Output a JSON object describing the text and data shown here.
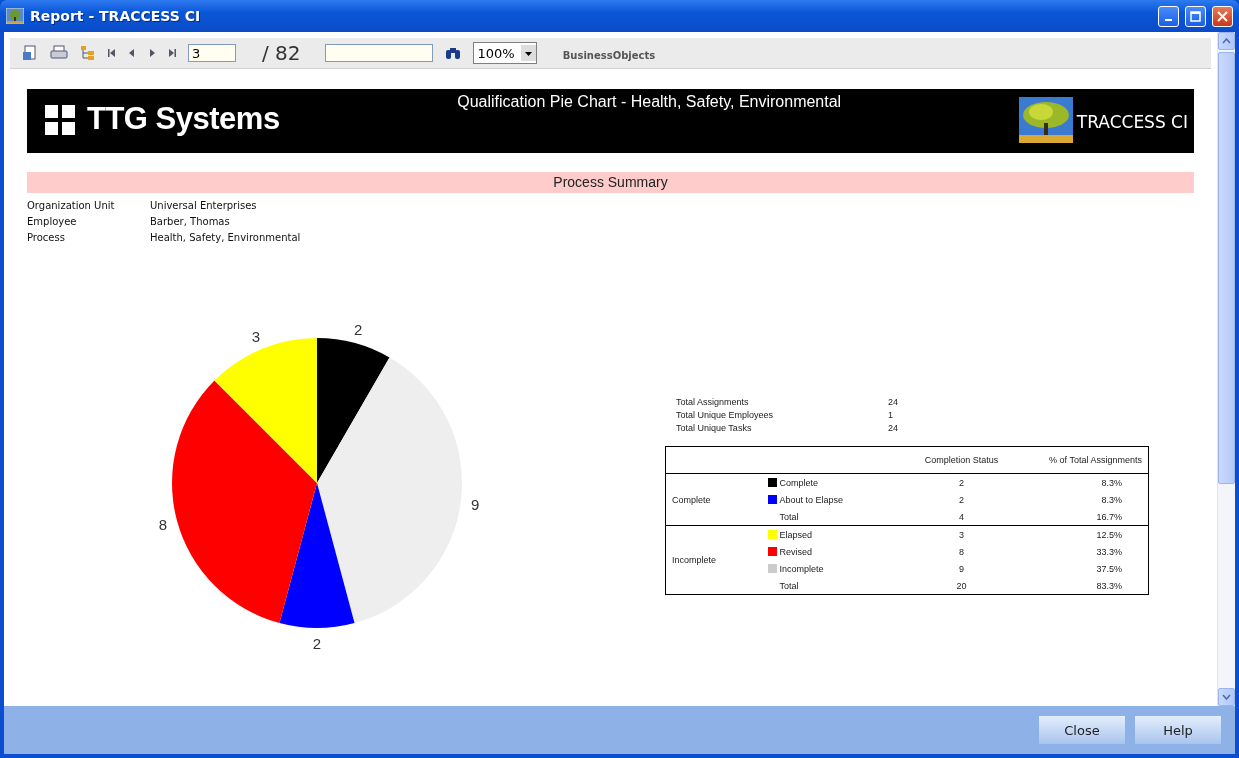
{
  "window": {
    "title": "Report - TRACCESS CI"
  },
  "toolbar": {
    "page": "3",
    "page_count": "/ 82",
    "zoom": "100%",
    "brand": "BusinessObjects"
  },
  "report": {
    "company": "TTG Systems",
    "title": "Qualification Pie Chart - Health, Safety, Environmental",
    "product": "TRACCESS CI",
    "section": "Process Summary",
    "fields": [
      {
        "label": "Organization Unit",
        "value": "Universal Enterprises"
      },
      {
        "label": "Employee",
        "value": "Barber, Thomas"
      },
      {
        "label": "Process",
        "value": "Health, Safety, Environmental"
      }
    ],
    "chart_data": {
      "type": "pie",
      "values": [
        2,
        9,
        2,
        8,
        3
      ],
      "colors": [
        "#000000",
        "#eeeeee",
        "#0000ff",
        "#ff0000",
        "#ffff00"
      ],
      "data_labels": true
    },
    "totals": [
      {
        "label": "Total Assignments",
        "value": "24"
      },
      {
        "label": "Total Unique Employees",
        "value": "1"
      },
      {
        "label": "Total Unique Tasks",
        "value": "24"
      }
    ],
    "table": {
      "columns": [
        "Completion Status",
        "% of Total Assignments"
      ],
      "groups": [
        {
          "name": "Complete",
          "rows": [
            {
              "kind": "item",
              "label": "Complete",
              "color": "#000000",
              "count": "2",
              "percent": "8.3%"
            },
            {
              "kind": "item",
              "label": "About to Elapse",
              "color": "#0000ff",
              "count": "2",
              "percent": "8.3%"
            },
            {
              "kind": "total",
              "label": "Total",
              "count": "4",
              "percent": "16.7%"
            }
          ]
        },
        {
          "name": "Incomplete",
          "rows": [
            {
              "kind": "item",
              "label": "Elapsed",
              "color": "#ffff00",
              "count": "3",
              "percent": "12.5%"
            },
            {
              "kind": "item",
              "label": "Revised",
              "color": "#ff0000",
              "count": "8",
              "percent": "33.3%"
            },
            {
              "kind": "item",
              "label": "Incomplete",
              "color": "#cccccc",
              "count": "9",
              "percent": "37.5%"
            },
            {
              "kind": "total",
              "label": "Total",
              "count": "20",
              "percent": "83.3%"
            }
          ]
        }
      ]
    }
  },
  "buttons": [
    "Close",
    "Help"
  ]
}
